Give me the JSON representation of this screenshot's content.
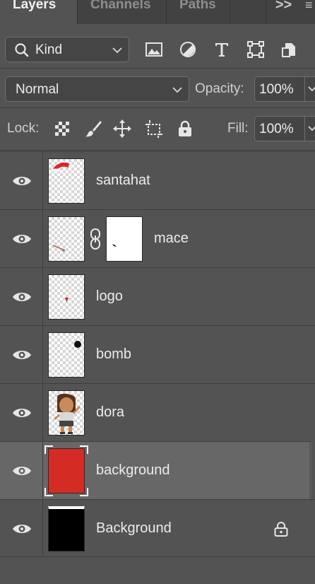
{
  "tabs": {
    "layers": "Layers",
    "channels": "Channels",
    "paths": "Paths",
    "more": ">>",
    "menu": "≡"
  },
  "filter": {
    "kind_label": "Kind",
    "icons": [
      "image-filter-icon",
      "adjustment-filter-icon",
      "type-filter-icon",
      "shape-filter-icon",
      "smart-object-filter-icon"
    ]
  },
  "blend": {
    "mode": "Normal",
    "opacity_label": "Opacity:",
    "opacity_value": "100%"
  },
  "lock": {
    "label": "Lock:",
    "fill_label": "Fill:",
    "fill_value": "100%"
  },
  "layers": [
    {
      "name": "santahat",
      "visible": true
    },
    {
      "name": "mace",
      "visible": true,
      "has_mask": true
    },
    {
      "name": "logo",
      "visible": true
    },
    {
      "name": "bomb",
      "visible": true
    },
    {
      "name": "dora",
      "visible": true
    },
    {
      "name": "background",
      "visible": true,
      "selected": true,
      "fill_color": "#d42c24"
    },
    {
      "name": "Background",
      "visible": true,
      "locked": true,
      "fill_color": "#000000"
    }
  ],
  "colors": {
    "panel": "#535353",
    "selected_row": "#676767",
    "red_fill": "#d42c24"
  }
}
